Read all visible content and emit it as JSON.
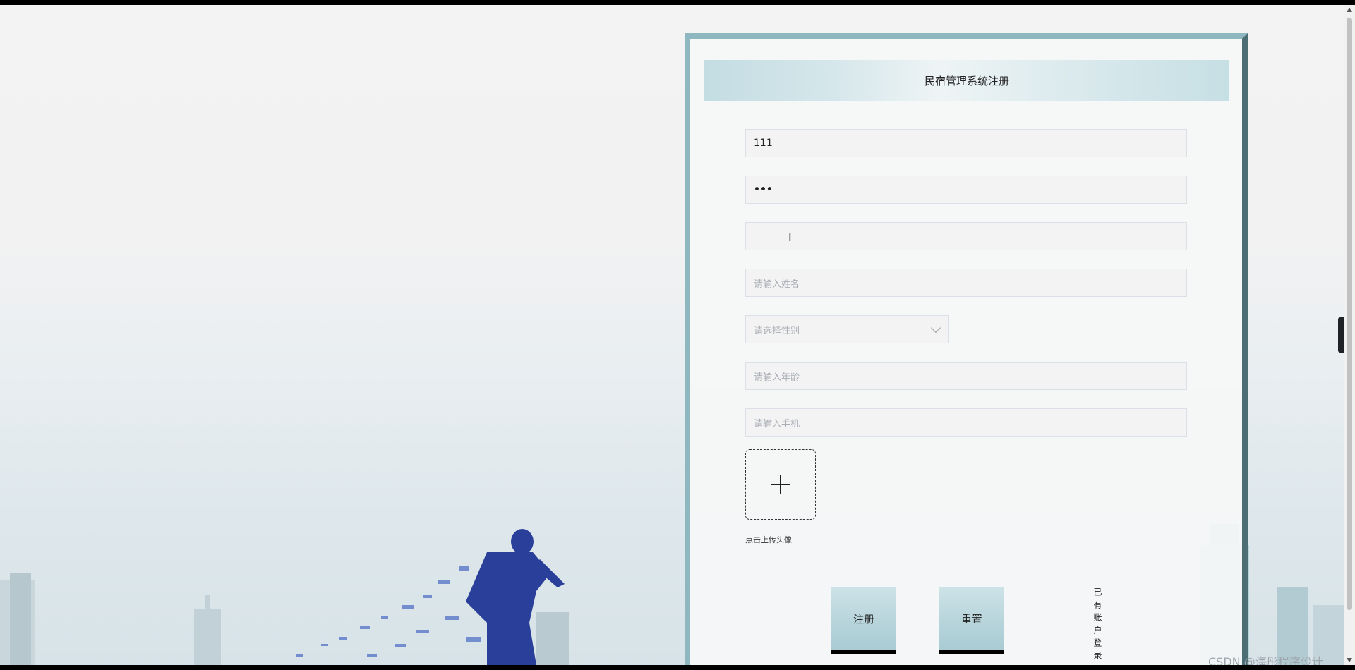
{
  "form": {
    "title": "民宿管理系统注册",
    "fields": {
      "account": {
        "value": "111"
      },
      "password": {
        "value": "•••"
      },
      "confirm_password": {
        "value": ""
      },
      "name": {
        "placeholder": "请输入姓名"
      },
      "gender": {
        "placeholder": "请选择性别"
      },
      "age": {
        "placeholder": "请输入年龄"
      },
      "phone": {
        "placeholder": "请输入手机"
      }
    },
    "avatar_upload": {
      "label": "点击上传头像"
    },
    "buttons": {
      "register": "注册",
      "reset": "重置"
    },
    "login_link": "已有账户登录"
  },
  "side_toggle": {
    "icon": "chevron-left-icon",
    "glyph": "‹"
  },
  "watermark": "CSDN @海彤程序设计",
  "colors": {
    "panel_border_light": "#8fb7c0",
    "panel_border_dark": "#4c6d73",
    "button_fill": "#b6d3da"
  }
}
